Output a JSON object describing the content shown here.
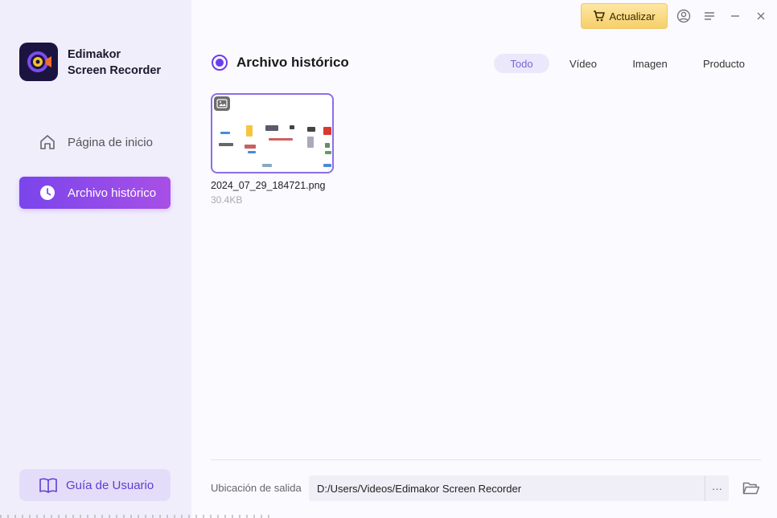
{
  "app": {
    "name_line1": "Edimakor",
    "name_line2": "Screen Recorder",
    "brand_color": "#7a45ec",
    "logo_icon": "edimakor-logo-icon"
  },
  "sidebar": {
    "items": [
      {
        "label": "Página de inicio",
        "icon": "home-icon",
        "active": false
      },
      {
        "label": "Archivo histórico",
        "icon": "clock-icon",
        "active": true
      }
    ],
    "guide_label": "Guía de Usuario",
    "guide_icon": "book-icon"
  },
  "titlebar": {
    "upgrade_label": "Actualizar",
    "upgrade_icon": "cart-icon",
    "controls": [
      "account-icon",
      "menu-icon",
      "minimize-icon",
      "close-icon"
    ]
  },
  "main": {
    "title": "Archivo histórico",
    "tabs": [
      {
        "label": "Todo",
        "active": true
      },
      {
        "label": "Vídeo",
        "active": false
      },
      {
        "label": "Imagen",
        "active": false
      },
      {
        "label": "Producto",
        "active": false
      }
    ],
    "files": [
      {
        "name": "2024_07_29_184721.png",
        "size": "30.4KB",
        "type_icon": "image-icon"
      }
    ]
  },
  "footer": {
    "output_label": "Ubicación de salida",
    "output_path": "D:/Users/Videos/Edimakor Screen Recorder",
    "browse_label": "···",
    "folder_icon": "folder-open-icon"
  }
}
